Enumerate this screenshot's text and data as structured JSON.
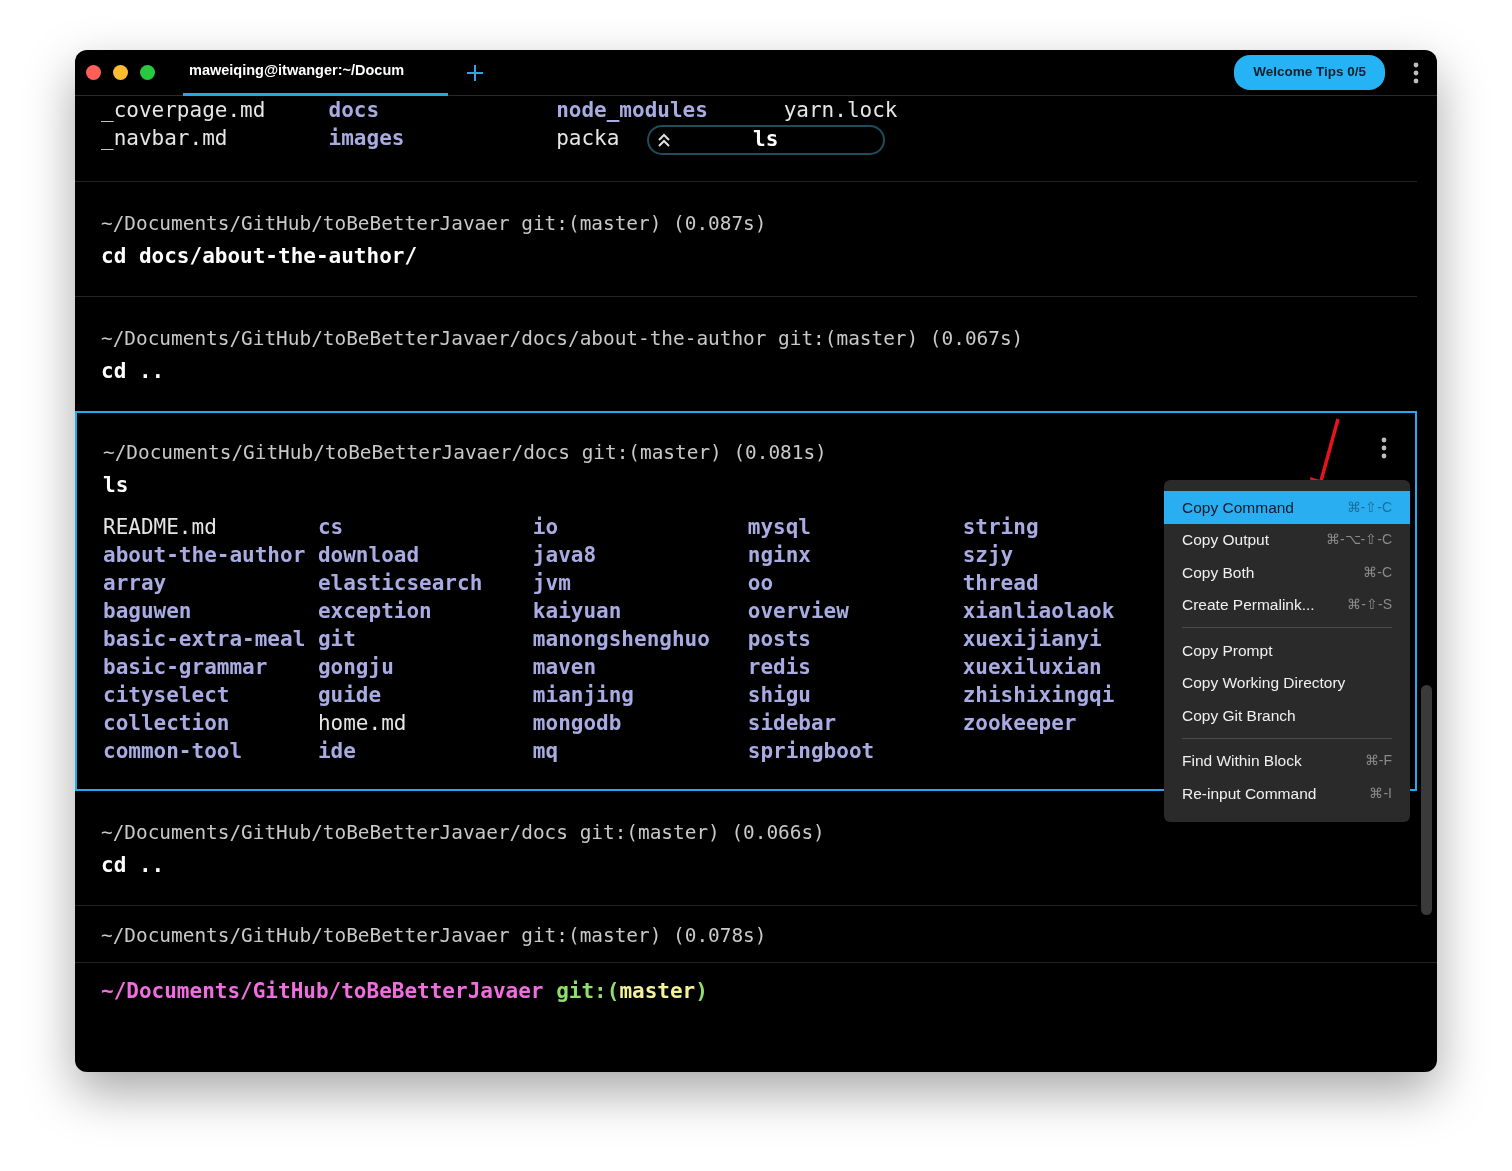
{
  "window": {
    "tab": {
      "title": "maweiqing@itwanger:~/Docum",
      "selected": true
    },
    "welcome_button": "Welcome Tips 0/5"
  },
  "sticky_command": "ls",
  "blocks": [
    {
      "selected": false,
      "output": [
        [
          {
            "name": "_coverpage.md",
            "kind": "file"
          },
          {
            "name": "docs",
            "kind": "dir"
          },
          {
            "name": "node_modules",
            "kind": "dir"
          },
          {
            "name": "yarn.lock",
            "kind": "file"
          }
        ],
        [
          {
            "name": "_navbar.md",
            "kind": "file"
          },
          {
            "name": "images",
            "kind": "dir"
          },
          {
            "name": "packa",
            "kind": "file"
          }
        ]
      ]
    },
    {
      "selected": false,
      "prompt": "~/Documents/GitHub/toBeBetterJavaer git:(master) (0.087s)",
      "command": "cd docs/about-the-author/"
    },
    {
      "selected": false,
      "prompt": "~/Documents/GitHub/toBeBetterJavaer/docs/about-the-author git:(master) (0.067s)",
      "command": "cd .."
    },
    {
      "selected": true,
      "prompt": "~/Documents/GitHub/toBeBetterJavaer/docs git:(master) (0.081s)",
      "command": "ls",
      "output": [
        [
          {
            "name": "README.md",
            "kind": "file"
          },
          {
            "name": "cs",
            "kind": "dir"
          },
          {
            "name": "io",
            "kind": "dir"
          },
          {
            "name": "mysql",
            "kind": "dir"
          },
          {
            "name": "string",
            "kind": "dir"
          }
        ],
        [
          {
            "name": "about-the-author",
            "kind": "dir"
          },
          {
            "name": "download",
            "kind": "dir"
          },
          {
            "name": "java8",
            "kind": "dir"
          },
          {
            "name": "nginx",
            "kind": "dir"
          },
          {
            "name": "szjy",
            "kind": "dir"
          }
        ],
        [
          {
            "name": "array",
            "kind": "dir"
          },
          {
            "name": "elasticsearch",
            "kind": "dir"
          },
          {
            "name": "jvm",
            "kind": "dir"
          },
          {
            "name": "oo",
            "kind": "dir"
          },
          {
            "name": "thread",
            "kind": "dir"
          }
        ],
        [
          {
            "name": "baguwen",
            "kind": "dir"
          },
          {
            "name": "exception",
            "kind": "dir"
          },
          {
            "name": "kaiyuan",
            "kind": "dir"
          },
          {
            "name": "overview",
            "kind": "dir"
          },
          {
            "name": "xianliaolaok",
            "kind": "dir"
          }
        ],
        [
          {
            "name": "basic-extra-meal",
            "kind": "dir"
          },
          {
            "name": "git",
            "kind": "dir"
          },
          {
            "name": "manongshenghuo",
            "kind": "dir"
          },
          {
            "name": "posts",
            "kind": "dir"
          },
          {
            "name": "xuexijianyi",
            "kind": "dir"
          }
        ],
        [
          {
            "name": "basic-grammar",
            "kind": "dir"
          },
          {
            "name": "gongju",
            "kind": "dir"
          },
          {
            "name": "maven",
            "kind": "dir"
          },
          {
            "name": "redis",
            "kind": "dir"
          },
          {
            "name": "xuexiluxian",
            "kind": "dir"
          }
        ],
        [
          {
            "name": "cityselect",
            "kind": "dir"
          },
          {
            "name": "guide",
            "kind": "dir"
          },
          {
            "name": "mianjing",
            "kind": "dir"
          },
          {
            "name": "shigu",
            "kind": "dir"
          },
          {
            "name": "zhishixingqi",
            "kind": "dir"
          }
        ],
        [
          {
            "name": "collection",
            "kind": "dir"
          },
          {
            "name": "home.md",
            "kind": "file"
          },
          {
            "name": "mongodb",
            "kind": "dir"
          },
          {
            "name": "sidebar",
            "kind": "dir"
          },
          {
            "name": "zookeeper",
            "kind": "dir"
          }
        ],
        [
          {
            "name": "common-tool",
            "kind": "dir"
          },
          {
            "name": "ide",
            "kind": "dir"
          },
          {
            "name": "mq",
            "kind": "dir"
          },
          {
            "name": "springboot",
            "kind": "dir"
          }
        ]
      ]
    },
    {
      "selected": false,
      "prompt": "~/Documents/GitHub/toBeBetterJavaer/docs git:(master) (0.066s)",
      "command": "cd .."
    },
    {
      "selected": false,
      "prompt": "~/Documents/GitHub/toBeBetterJavaer git:(master) (0.078s)"
    }
  ],
  "context_menu": {
    "groups": [
      [
        {
          "label": "Copy Command",
          "shortcut": "⌘-⇧-C",
          "selected": true
        },
        {
          "label": "Copy Output",
          "shortcut": "⌘-⌥-⇧-C",
          "selected": false
        },
        {
          "label": "Copy Both",
          "shortcut": "⌘-C",
          "selected": false
        },
        {
          "label": "Create Permalink...",
          "shortcut": "⌘-⇧-S",
          "selected": false
        }
      ],
      [
        {
          "label": "Copy Prompt",
          "selected": false
        },
        {
          "label": "Copy Working Directory",
          "selected": false
        },
        {
          "label": "Copy Git Branch",
          "selected": false
        }
      ],
      [
        {
          "label": "Find Within Block",
          "shortcut": "⌘-F",
          "selected": false
        },
        {
          "label": "Re-input Command",
          "shortcut": "⌘-I",
          "selected": false
        }
      ]
    ]
  },
  "input_prompt": {
    "path": "~/Documents/GitHub/toBeBetterJavaer",
    "git_open": "git:(",
    "branch": "master",
    "git_close": ")"
  }
}
